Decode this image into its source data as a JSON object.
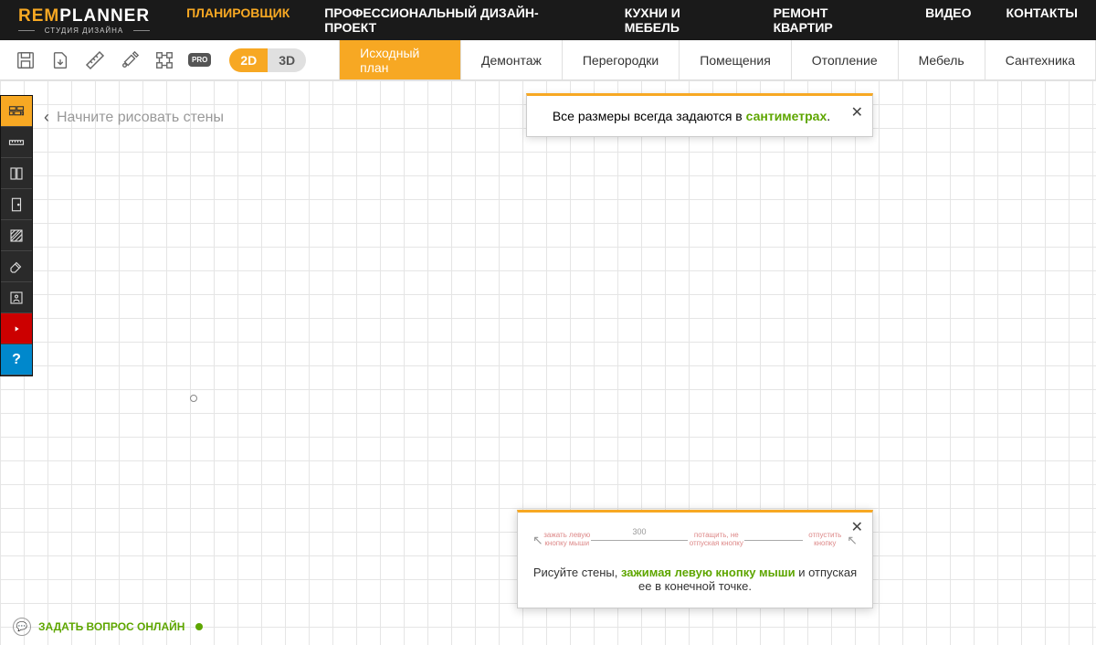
{
  "logo": {
    "brand_rem": "REM",
    "brand_rest": "PLANNER",
    "subtitle": "СТУДИЯ ДИЗАЙНА"
  },
  "nav": {
    "items": [
      {
        "label": "ПЛАНИРОВЩИК",
        "active": true
      },
      {
        "label": "ПРОФЕССИОНАЛЬНЫЙ ДИЗАЙН-ПРОЕКТ"
      },
      {
        "label": "КУХНИ И МЕБЕЛЬ"
      },
      {
        "label": "РЕМОНТ КВАРТИР"
      },
      {
        "label": "ВИДЕО"
      },
      {
        "label": "КОНТАКТЫ"
      }
    ]
  },
  "toolbar": {
    "icons": [
      "save",
      "export",
      "ruler",
      "tools",
      "snap",
      "pro"
    ],
    "pro_label": "PRO",
    "view2d": "2D",
    "view3d": "3D"
  },
  "tabs": [
    {
      "label": "Исходный план",
      "active": true
    },
    {
      "label": "Демонтаж"
    },
    {
      "label": "Перегородки"
    },
    {
      "label": "Помещения"
    },
    {
      "label": "Отопление"
    },
    {
      "label": "Мебель"
    },
    {
      "label": "Сантехника"
    }
  ],
  "sidebar": {
    "items": [
      "wall",
      "ruler-h",
      "panel",
      "door",
      "hatch",
      "eraser",
      "room",
      "youtube",
      "help"
    ]
  },
  "hint": {
    "text": "Начните рисовать стены"
  },
  "tip": {
    "prefix": "Все размеры всегда задаются в ",
    "highlight": "сантиметрах",
    "suffix": "."
  },
  "tutorial": {
    "dim_label": "300",
    "label_left": "зажать левую\nкнопку мыши",
    "label_mid": "потащить, не\nотпуская кнопку",
    "label_right": "отпустить\nкнопку",
    "text_prefix": "Рисуйте стены, ",
    "text_highlight": "зажимая левую кнопку мыши",
    "text_suffix": " и отпуская ее в конечной точке."
  },
  "chat": {
    "label": "ЗАДАТЬ ВОПРОС ОНЛАЙН"
  }
}
